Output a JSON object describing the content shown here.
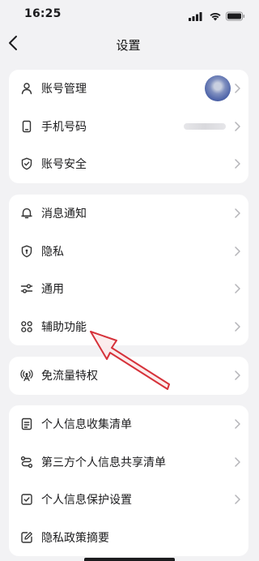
{
  "status_bar": {
    "time": "16:25"
  },
  "header": {
    "title": "设置"
  },
  "groups": [
    {
      "items": [
        {
          "label": "账号管理",
          "icon": "person-icon"
        },
        {
          "label": "手机号码",
          "icon": "phone-icon"
        },
        {
          "label": "账号安全",
          "icon": "shield-check-icon"
        }
      ]
    },
    {
      "items": [
        {
          "label": "消息通知",
          "icon": "bell-icon"
        },
        {
          "label": "隐私",
          "icon": "privacy-shield-icon"
        },
        {
          "label": "通用",
          "icon": "sliders-icon"
        },
        {
          "label": "辅助功能",
          "icon": "command-icon"
        }
      ]
    },
    {
      "items": [
        {
          "label": "免流量特权",
          "icon": "signal-tower-icon"
        }
      ]
    },
    {
      "items": [
        {
          "label": "个人信息收集清单",
          "icon": "document-list-icon"
        },
        {
          "label": "第三方个人信息共享清单",
          "icon": "share-route-icon"
        },
        {
          "label": "个人信息保护设置",
          "icon": "checkbox-icon"
        },
        {
          "label": "隐私政策摘要",
          "icon": "edit-icon"
        }
      ]
    }
  ],
  "colors": {
    "background": "#f2f2f4",
    "annotation_arrow": "#d6323a",
    "chevron": "#b4b4b8"
  }
}
